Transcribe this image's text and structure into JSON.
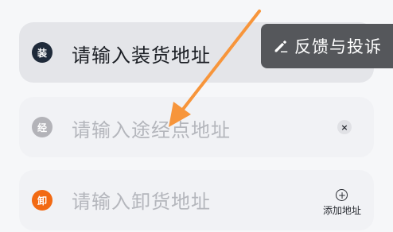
{
  "address_rows": {
    "load": {
      "badge": "装",
      "text": "请输入装货地址"
    },
    "via": {
      "badge": "经",
      "placeholder": "请输入途经点地址",
      "clear_icon": "×"
    },
    "unload": {
      "badge": "卸",
      "placeholder": "请输入卸货地址",
      "add_icon": "+",
      "add_label": "添加地址"
    }
  },
  "feedback_button": {
    "icon": "edit-pencil-icon",
    "label": "反馈与投诉"
  },
  "annotation": {
    "icon": "arrow-pointer",
    "color": "#f7953b"
  },
  "colors": {
    "load_badge": "#1f2a3a",
    "via_badge": "#b3b3b8",
    "unload_badge": "#f26a13",
    "feedback_bg": "#55575b"
  }
}
